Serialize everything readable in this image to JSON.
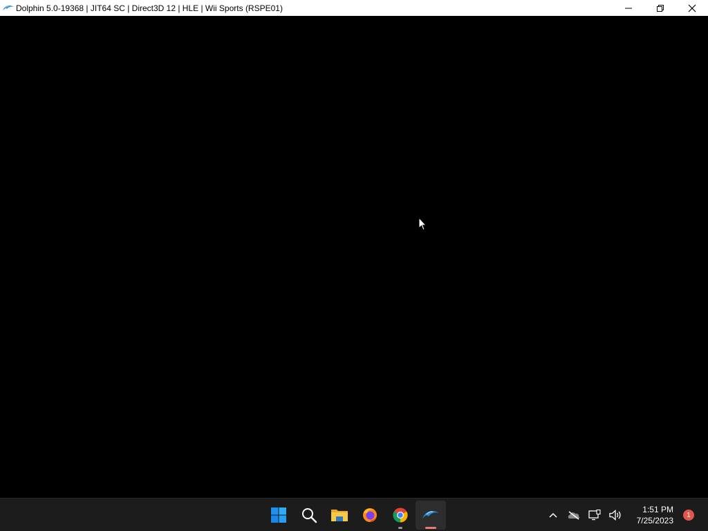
{
  "window": {
    "title": "Dolphin 5.0-19368 | JIT64 SC | Direct3D 12 | HLE | Wii Sports (RSPE01)",
    "icon": "dolphin-icon",
    "controls": [
      "minimize-icon",
      "restore-icon",
      "close-icon"
    ]
  },
  "viewport": {
    "background": "#000000"
  },
  "taskbar": {
    "apps": [
      {
        "name": "start",
        "icon": "windows-logo-icon"
      },
      {
        "name": "search",
        "icon": "search-icon"
      },
      {
        "name": "file-explorer",
        "icon": "folder-icon"
      },
      {
        "name": "firefox",
        "icon": "firefox-icon"
      },
      {
        "name": "chrome",
        "icon": "chrome-icon",
        "running": true
      },
      {
        "name": "dolphin",
        "icon": "dolphin-icon",
        "running": true,
        "active": true
      }
    ],
    "tray": {
      "icons": [
        "chevron-up-icon",
        "onedrive-offline-icon",
        "network-icon",
        "volume-icon"
      ],
      "time": "1:51 PM",
      "date": "7/25/2023",
      "notification_count": "1"
    },
    "colors": {
      "background": "#1c1c1c",
      "active_indicator": "#e67e73",
      "notification_badge": "#e2574c"
    }
  }
}
